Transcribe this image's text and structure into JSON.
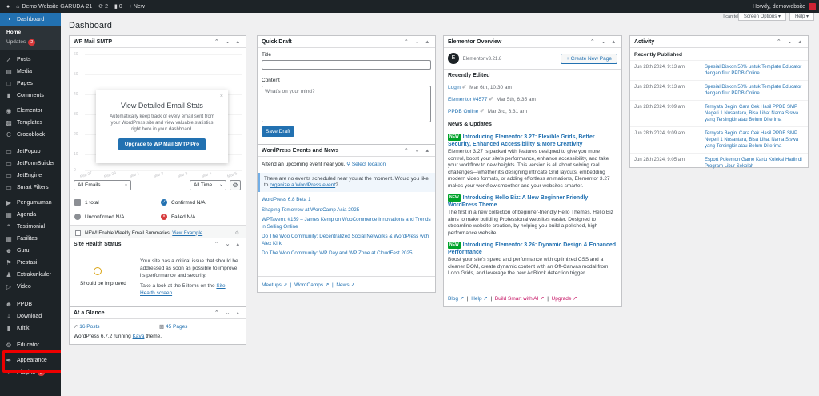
{
  "admin_bar": {
    "site_name": "Demo Website GARUDA-21",
    "updates_count": "2",
    "comments_count": "0",
    "new_label": "New",
    "howdy": "Howdy, demowebsite"
  },
  "sidebar": {
    "dashboard": "Dashboard",
    "home": "Home",
    "updates": "Updates",
    "updates_badge": "2",
    "items": [
      {
        "label": "Posts",
        "icon": "pin-icon"
      },
      {
        "label": "Media",
        "icon": "media-icon"
      },
      {
        "label": "Pages",
        "icon": "pages-icon"
      },
      {
        "label": "Comments",
        "icon": "comments-icon"
      },
      {
        "label": "Elementor",
        "icon": "elementor-icon"
      },
      {
        "label": "Templates",
        "icon": "templates-icon"
      },
      {
        "label": "Crocoblock",
        "icon": "crocoblock-icon"
      },
      {
        "label": "JetPopup",
        "icon": "jet-icon"
      },
      {
        "label": "JetFormBuilder",
        "icon": "jet-icon"
      },
      {
        "label": "JetEngine",
        "icon": "jet-icon"
      },
      {
        "label": "Smart Filters",
        "icon": "jet-icon"
      },
      {
        "label": "Pengumuman",
        "icon": "megaphone-icon"
      },
      {
        "label": "Agenda",
        "icon": "calendar-icon"
      },
      {
        "label": "Testimonial",
        "icon": "quote-icon"
      },
      {
        "label": "Fasilitas",
        "icon": "building-icon"
      },
      {
        "label": "Guru",
        "icon": "users-icon"
      },
      {
        "label": "Prestasi",
        "icon": "flag-icon"
      },
      {
        "label": "Extrakurikuler",
        "icon": "group-icon"
      },
      {
        "label": "Video",
        "icon": "video-icon"
      },
      {
        "label": "PPDB",
        "icon": "users-icon"
      },
      {
        "label": "Download",
        "icon": "download-icon"
      },
      {
        "label": "Kritik",
        "icon": "comment-icon"
      },
      {
        "label": "Educator",
        "icon": "gear-icon"
      },
      {
        "label": "Appearance",
        "icon": "brush-icon"
      },
      {
        "label": "Plugins",
        "icon": "plugin-icon",
        "badge": "2"
      }
    ]
  },
  "header": {
    "title": "Dashboard",
    "cant_tell": "I can tell. Dolly",
    "screen_options": "Screen Options",
    "help": "Help"
  },
  "wp_mail": {
    "title": "WP Mail SMTP",
    "y_ticks": [
      "60",
      "50",
      "40",
      "30",
      "20",
      "10",
      "0"
    ],
    "x_ticks": [
      "Feb 27",
      "Feb 28",
      "Mar 1",
      "Mar 2",
      "Mar 3",
      "Mar 4",
      "Mar 5"
    ],
    "modal_title": "View Detailed Email Stats",
    "modal_desc": "Automatically keep track of every email sent from your WordPress site and view valuable statistics right here in your dashboard.",
    "modal_button": "Upgrade to WP Mail SMTP Pro",
    "filter_emails": "All Emails",
    "filter_time": "All Time",
    "total": "1 total",
    "confirmed": "Confirmed N/A",
    "unconfirmed": "Unconfirmed N/A",
    "failed": "Failed N/A",
    "weekly_text": "NEW! Enable Weekly Email Summaries",
    "weekly_link": "View Example"
  },
  "site_health": {
    "title": "Site Health Status",
    "status": "Should be improved",
    "text": "Your site has a critical issue that should be addressed as soon as possible to improve its performance and security.",
    "text2": "Take a look at the 5 items on the",
    "link": "Site Health screen"
  },
  "glance": {
    "title": "At a Glance",
    "posts": "16 Posts",
    "pages": "45 Pages",
    "running": "WordPress 6.7.2 running",
    "theme": "Kava",
    "theme_suffix": "theme."
  },
  "quick_draft": {
    "title": "Quick Draft",
    "title_label": "Title",
    "content_label": "Content",
    "content_placeholder": "What's on your mind?",
    "save": "Save Draft"
  },
  "events": {
    "title": "WordPress Events and News",
    "attend": "Attend an upcoming event near you.",
    "select_location": "Select location",
    "notice": "There are no events scheduled near you at the moment. Would you like to",
    "notice_link": "organize a WordPress event",
    "links": [
      "WordPress 6.8 Beta 1",
      "Shaping Tomorrow at WordCamp Asia 2025",
      "WPTavern: #159 – James Kemp on WooCommerce Innovations and Trends in Selling Online",
      "Do The Woo Community: Decentralized Social Networks & WordPress with Alex Kirk",
      "Do The Woo Community: WP Day and WP Zone at CloudFest 2025"
    ],
    "footer": [
      "Meetups",
      "WordCamps",
      "News"
    ]
  },
  "elementor": {
    "title": "Elementor Overview",
    "version": "Elementor v3.21.8",
    "create": "+ Create New Page",
    "recent_title": "Recently Edited",
    "recent": [
      {
        "name": "Login",
        "date": "Mar 6th, 10:30 am"
      },
      {
        "name": "Elementor #4577",
        "date": "Mar 5th, 6:35 am"
      },
      {
        "name": "PPDB Online",
        "date": "Mar 3rd, 6:31 am"
      }
    ],
    "news_title": "News & Updates",
    "news_badge": "NEW",
    "news": [
      {
        "title": "Introducing Elementor 3.27: Flexible Grids, Better Security, Enhanced Accessibility & More Creativity",
        "text": "Elementor 3.27 is packed with features designed to give you more control, boost your site's performance, enhance accessibility, and take your workflow to new heights. This version is all about solving real challenges—whether it's designing intricate Grid layouts, embedding modern video formats, or adding effortless animations, Elementor 3.27 makes your workflow smoother and your websites smarter."
      },
      {
        "title": "Introducing Hello Biz: A New Beginner Friendly WordPress Theme",
        "text": "The first in a new collection of beginner-friendly Hello Themes, Hello Biz aims to make building Professional websites easier. Designed to streamline website creation, by helping you build a polished, high-performance website."
      },
      {
        "title": "Introducing Elementor 3.26: Dynamic Design & Enhanced Performance",
        "text": "Boost your site's speed and performance with optimized CSS and a cleaner DOM, create dynamic content with an Off-Canvas modal from Loop Grids, and leverage the new AdBlock detection trigger."
      }
    ],
    "footer": [
      "Blog",
      "Help",
      "Build Smart with AI",
      "Upgrade"
    ]
  },
  "activity": {
    "title": "Activity",
    "recent_title": "Recently Published",
    "rows": [
      {
        "date": "Jun 28th 2024, 9:13 am",
        "title": "Spesial Diskon 50% untuk Template Educator dengan fitur PPDB Online"
      },
      {
        "date": "Jun 28th 2024, 9:13 am",
        "title": "Spesial Diskon 50% untuk Template Educator dengan fitur PPDB Online"
      },
      {
        "date": "Jun 28th 2024, 9:09 am",
        "title": "Ternyata Begini Cara Cek Hasil PPDB SMP Negeri 1 Nusantara, Bisa Lihat Nama Siswa yang Tersingkir atau Belum Diterima"
      },
      {
        "date": "Jun 28th 2024, 9:09 am",
        "title": "Ternyata Begini Cara Cek Hasil PPDB SMP Negeri 1 Nusantara, Bisa Lihat Nama Siswa yang Tersingkir atau Belum Diterima"
      },
      {
        "date": "Jun 28th 2024, 9:05 am",
        "title": "Esport Pokemon Game Kartu Koleksi Hadir di Program Libur Sekolah"
      }
    ]
  },
  "colors": {
    "admin_dark": "#1d2327",
    "accent": "#2271b1",
    "highlight": "#ee0000"
  }
}
